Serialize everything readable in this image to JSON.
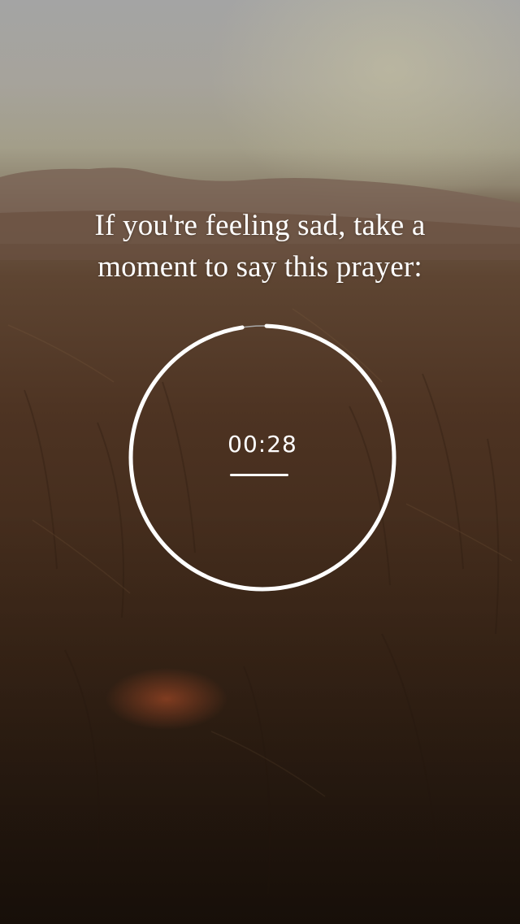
{
  "prompt": {
    "line1": "If you're feeling sad, take a",
    "line2": "moment to say this prayer:"
  },
  "timer": {
    "display": "00:28",
    "progress": 0.97
  },
  "colors": {
    "text": "#ffffff",
    "ring": "#ffffff",
    "ring_track": "#a8a8a8"
  }
}
